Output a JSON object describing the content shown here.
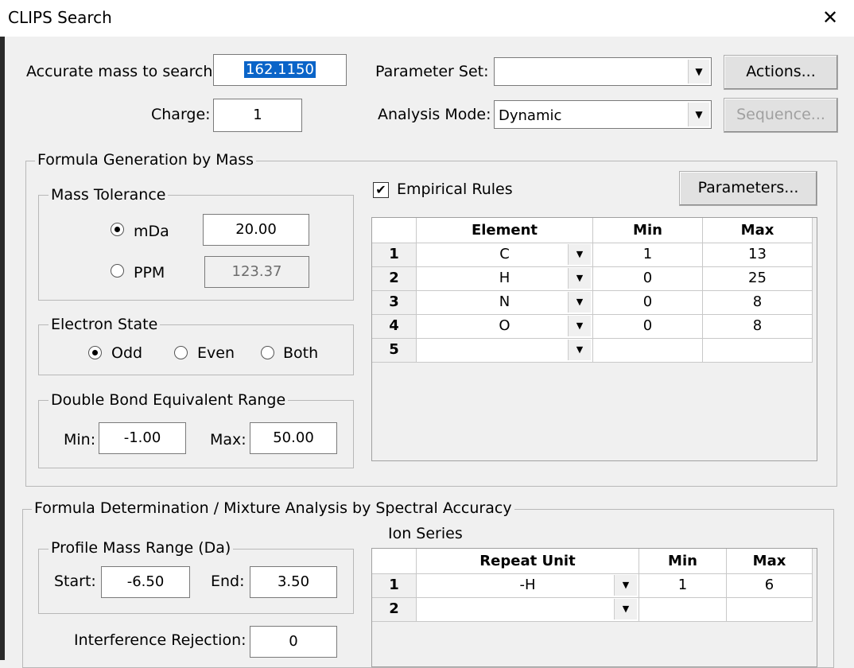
{
  "window": {
    "title": "CLIPS Search",
    "close_glyph": "✕"
  },
  "top": {
    "mass_label": "Accurate mass to search:",
    "mass_value": "162.1150",
    "charge_label": "Charge:",
    "charge_value": "1",
    "param_set_label": "Parameter Set:",
    "param_set_value": "",
    "analysis_mode_label": "Analysis Mode:",
    "analysis_mode_value": "Dynamic",
    "actions_button": "Actions...",
    "sequence_button": "Sequence..."
  },
  "formula_gen": {
    "title": "Formula Generation by Mass",
    "mass_tolerance": {
      "title": "Mass Tolerance",
      "mda_label": "mDa",
      "mda_value": "20.00",
      "mda_selected": true,
      "ppm_label": "PPM",
      "ppm_value": "123.37"
    },
    "electron_state": {
      "title": "Electron State",
      "options": [
        "Odd",
        "Even",
        "Both"
      ],
      "selected": "Odd"
    },
    "dbe": {
      "title": "Double Bond Equivalent Range",
      "min_label": "Min:",
      "min_value": "-1.00",
      "max_label": "Max:",
      "max_value": "50.00"
    },
    "empirical_rules_label": "Empirical Rules",
    "empirical_rules_checked": true,
    "parameters_button": "Parameters...",
    "element_table": {
      "headers": [
        "Element",
        "Min",
        "Max"
      ],
      "rows": [
        {
          "n": "1",
          "element": "C",
          "min": "1",
          "max": "13"
        },
        {
          "n": "2",
          "element": "H",
          "min": "0",
          "max": "25"
        },
        {
          "n": "3",
          "element": "N",
          "min": "0",
          "max": "8"
        },
        {
          "n": "4",
          "element": "O",
          "min": "0",
          "max": "8"
        },
        {
          "n": "5",
          "element": "",
          "min": "",
          "max": ""
        }
      ]
    }
  },
  "formula_det": {
    "title": "Formula Determination / Mixture Analysis by Spectral Accuracy",
    "profile_range": {
      "title": "Profile Mass Range (Da)",
      "start_label": "Start:",
      "start_value": "-6.50",
      "end_label": "End:",
      "end_value": "3.50"
    },
    "interference_label": "Interference Rejection:",
    "interference_value": "0",
    "ion_series_label": "Ion Series",
    "ion_table": {
      "headers": [
        "Repeat Unit",
        "Min",
        "Max"
      ],
      "rows": [
        {
          "n": "1",
          "unit": "-H",
          "min": "1",
          "max": "6"
        },
        {
          "n": "2",
          "unit": "",
          "min": "",
          "max": ""
        }
      ]
    }
  },
  "icons": {
    "dropdown": "▼",
    "check": "✔"
  }
}
